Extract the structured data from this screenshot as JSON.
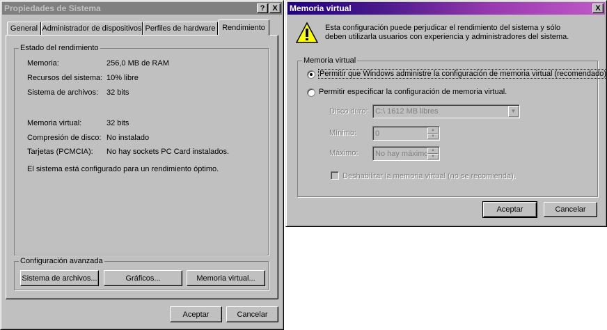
{
  "sys": {
    "title": "Propiedades de Sistema",
    "help_btn": "?",
    "close_btn": "X",
    "tabs": [
      "General",
      "Administrador de dispositivos",
      "Perfiles de hardware",
      "Rendimiento"
    ],
    "status_group": "Estado del rendimiento",
    "rows": [
      {
        "label": "Memoria:",
        "value": "256,0 MB de RAM"
      },
      {
        "label": "Recursos del sistema:",
        "value": "10% libre"
      },
      {
        "label": "Sistema de archivos:",
        "value": "32 bits"
      },
      {
        "label": "Memoria virtual:",
        "value": "32 bits"
      },
      {
        "label": "Compresión de disco:",
        "value": "No instalado"
      },
      {
        "label": "Tarjetas (PCMCIA):",
        "value": "No hay sockets PC Card instalados."
      }
    ],
    "status_message": "El sistema está configurado para un rendimiento óptimo.",
    "advanced_group": "Configuración avanzada",
    "btn_filesystem": "Sistema de archivos...",
    "btn_graphics": "Gráficos...",
    "btn_virtual": "Memoria virtual...",
    "btn_ok": "Aceptar",
    "btn_cancel": "Cancelar"
  },
  "vm": {
    "title": "Memoria virtual",
    "close_btn": "X",
    "warning": "Esta configuración puede perjudicar el rendimiento del sistema y sólo deben utilizarla usuarios con experiencia y administradores del sistema.",
    "group": "Memoria virtual",
    "option_auto": "Permitir que Windows administre la configuración de memoria virtual (recomendado).",
    "option_manual": "Permitir especificar la configuración de memoria virtual.",
    "disk_label": "Disco duro:",
    "disk_value": "C:\\ 1612 MB libres",
    "min_label": "Mínimo:",
    "min_value": "0",
    "max_label": "Máximo:",
    "max_value": "No hay máximo",
    "disable_label": "Deshabilitar  la memoria virtual (no se recomienda).",
    "btn_ok": "Aceptar",
    "btn_cancel": "Cancelar"
  }
}
